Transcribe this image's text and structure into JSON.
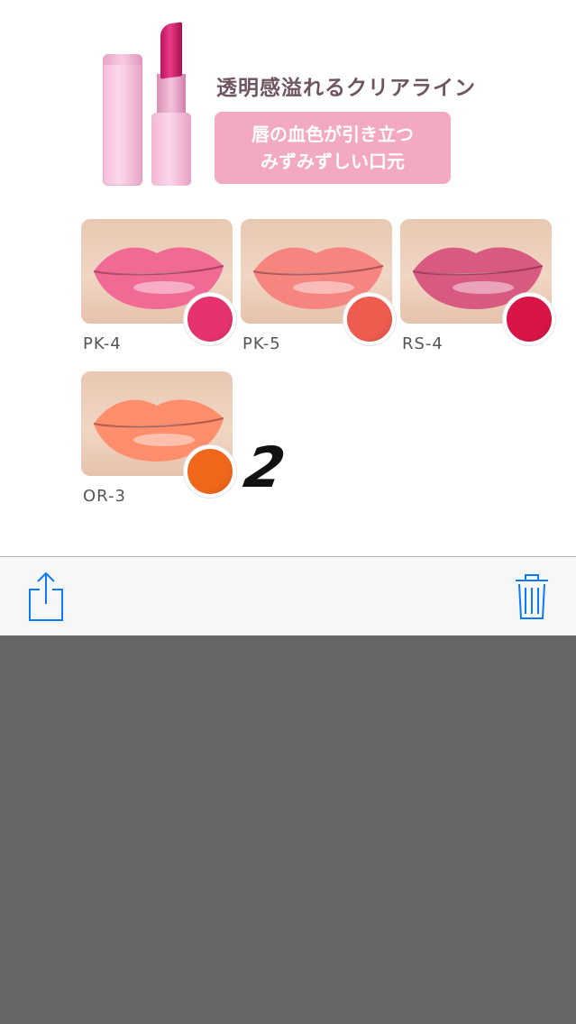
{
  "photo": {
    "headline": "透明感溢れるクリアライン",
    "tagline_line1": "唇の血色が引き立つ",
    "tagline_line2": "みずみずしい口元",
    "swatches": [
      {
        "code": "PK-4",
        "lip_color": "#f06a94",
        "dot_color": "#e6336f"
      },
      {
        "code": "PK-5",
        "lip_color": "#f6857f",
        "dot_color": "#ee5b4f"
      },
      {
        "code": "RS-4",
        "lip_color": "#d95a80",
        "dot_color": "#d81546"
      },
      {
        "code": "OR-3",
        "lip_color": "#ff8e6c",
        "dot_color": "#f0661b"
      }
    ],
    "badge": "2"
  },
  "toolbar": {
    "share_icon": "share-icon",
    "trash_icon": "trash-icon",
    "accent_color": "#0a7aff"
  }
}
